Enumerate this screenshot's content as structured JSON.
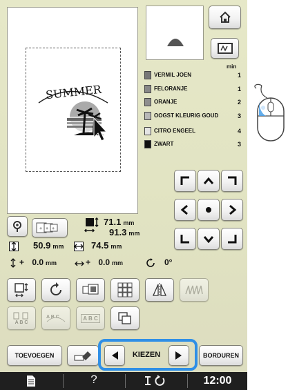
{
  "colors": {
    "accent_frame": "#2f8fe6",
    "lcd_bg": "#e3e5c4",
    "bottom_bar": "#1f1f1f"
  },
  "design": {
    "text": "SUMMER"
  },
  "icons": {
    "home": "home-icon",
    "zoom": "magnify-icon",
    "display": "screen-icon"
  },
  "thread": {
    "min_label": "min",
    "colors": [
      {
        "name": "VERMIL JOEN",
        "min": "1",
        "swatch": "#777777"
      },
      {
        "name": "FELORANJE",
        "min": "1",
        "swatch": "#888888"
      },
      {
        "name": "ORANJE",
        "min": "2",
        "swatch": "#8e8e8e"
      },
      {
        "name": "OOGST KLEURIG GOUD",
        "min": "3",
        "swatch": "#b8b8b8"
      },
      {
        "name": "CITRO ENGEEL",
        "min": "4",
        "swatch": "#e4e4e4"
      },
      {
        "name": "ZWART",
        "min": "3",
        "swatch": "#111111"
      }
    ]
  },
  "size": {
    "height_value": "71.1",
    "width_value": "91.3",
    "unit": "mm"
  },
  "position": {
    "vertical_value": "50.9",
    "horizontal_value": "74.5",
    "unit": "mm"
  },
  "offset": {
    "y_sign": "+",
    "y_value": "0.0",
    "x_sign": "+",
    "x_value": "0.0",
    "unit": "mm",
    "rotation": "0°"
  },
  "editor": {
    "abc1": "A B C",
    "abc2": "A B C",
    "abc3": "A B C"
  },
  "footer": {
    "add_label": "TOEVOEGEN",
    "select_label": "KIEZEN",
    "embroider_label": "BORDUREN",
    "help_label": "?",
    "time": "12:00"
  }
}
